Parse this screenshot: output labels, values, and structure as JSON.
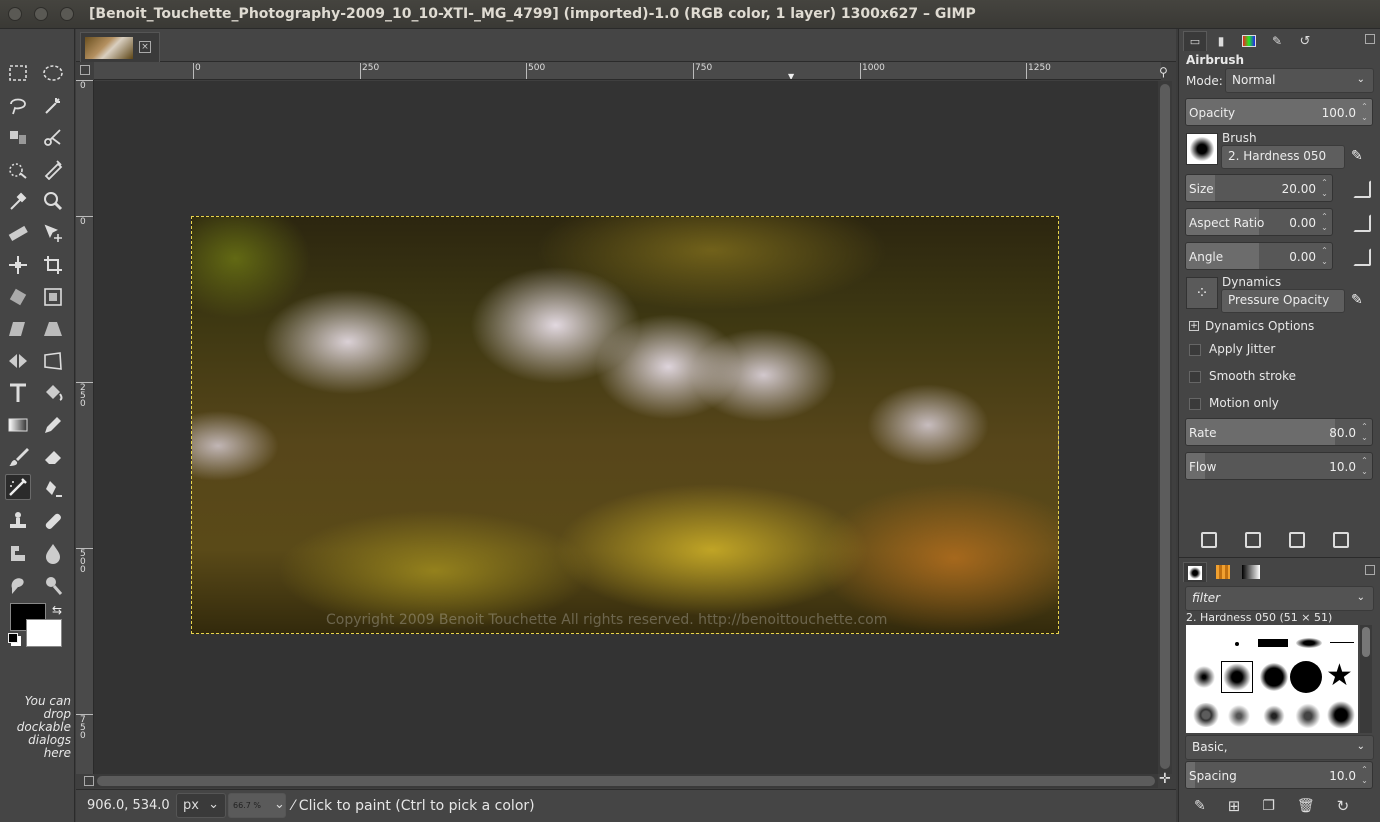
{
  "window": {
    "title": "[Benoit_Touchette_Photography-2009_10_10-XTI-_MG_4799] (imported)-1.0 (RGB color, 1 layer) 1300x627 – GIMP"
  },
  "toolbox": {
    "drop_note": "You can drop dockable dialogs here"
  },
  "image_tab": {
    "close": "×"
  },
  "ruler": {
    "h_labels": [
      "0",
      "250",
      "500",
      "750",
      "1000",
      "1250"
    ],
    "v_labels": [
      "0",
      "0",
      "250",
      "500",
      "750"
    ]
  },
  "canvas": {
    "watermark": "Copyright 2009 Benoit Touchette All rights reserved. http://benoittouchette.com"
  },
  "status": {
    "coords": "906.0, 534.0",
    "unit": "px",
    "zoom": "66.7 %",
    "message": "Click to paint (Ctrl to pick a color)"
  },
  "tool_options": {
    "title": "Airbrush",
    "mode_label": "Mode:",
    "mode_value": "Normal",
    "opacity_label": "Opacity",
    "opacity_value": "100.0",
    "opacity_fraction": 1.0,
    "brush_label": "Brush",
    "brush_value": "2. Hardness 050",
    "size_label": "Size",
    "size_value": "20.00",
    "size_fraction": 0.2,
    "aspect_label": "Aspect Ratio",
    "aspect_value": "0.00",
    "aspect_fraction": 0.5,
    "angle_label": "Angle",
    "angle_value": "0.00",
    "angle_fraction": 0.5,
    "dynamics_label": "Dynamics",
    "dynamics_value": "Pressure Opacity",
    "dynamics_options": "Dynamics Options",
    "apply_jitter": "Apply Jitter",
    "smooth_stroke": "Smooth stroke",
    "motion_only": "Motion only",
    "rate_label": "Rate",
    "rate_value": "80.0",
    "rate_fraction": 0.8,
    "flow_label": "Flow",
    "flow_value": "10.0",
    "flow_fraction": 0.1
  },
  "brushes": {
    "filter_placeholder": "filter",
    "current": "2. Hardness 050 (51 × 51)",
    "tag_value": "Basic,",
    "spacing_label": "Spacing",
    "spacing_value": "10.0",
    "spacing_fraction": 0.05
  },
  "colors": {
    "foreground": "#000000",
    "background": "#ffffff",
    "selection_outline": "#e8d44d"
  }
}
